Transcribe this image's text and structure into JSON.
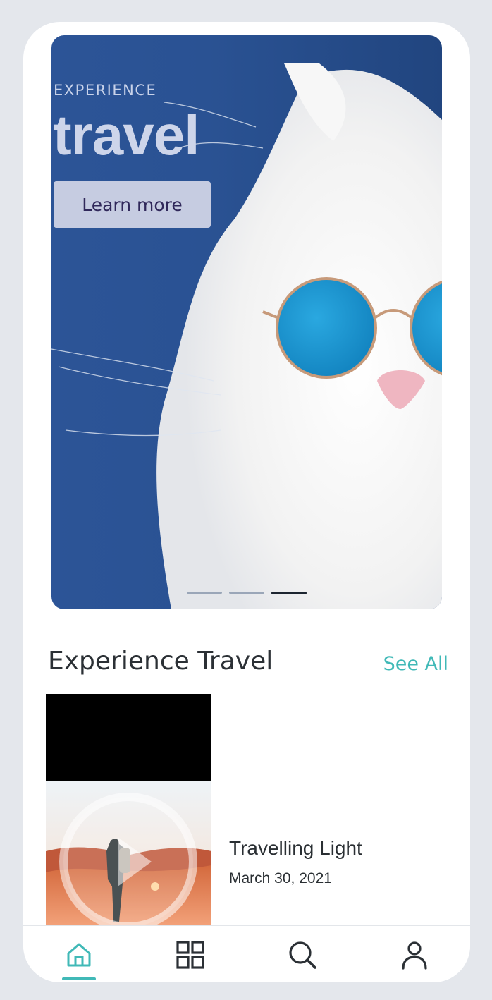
{
  "hero": {
    "eyebrow": "EXPERIENCE",
    "headline": "travel",
    "button_label": "Learn more",
    "carousel": {
      "total": 3,
      "active_index": 2
    }
  },
  "section": {
    "title": "Experience Travel",
    "see_all_label": "See All"
  },
  "card": {
    "title": "Travelling Light",
    "date": "March 30, 2021"
  },
  "nav": {
    "items": [
      {
        "icon": "home-icon",
        "active": true
      },
      {
        "icon": "grid-icon",
        "active": false
      },
      {
        "icon": "search-icon",
        "active": false
      },
      {
        "icon": "profile-icon",
        "active": false
      }
    ]
  },
  "colors": {
    "accent": "#40b9b7",
    "hero_background": "#2a5293",
    "page_background": "#e4e7ec"
  }
}
